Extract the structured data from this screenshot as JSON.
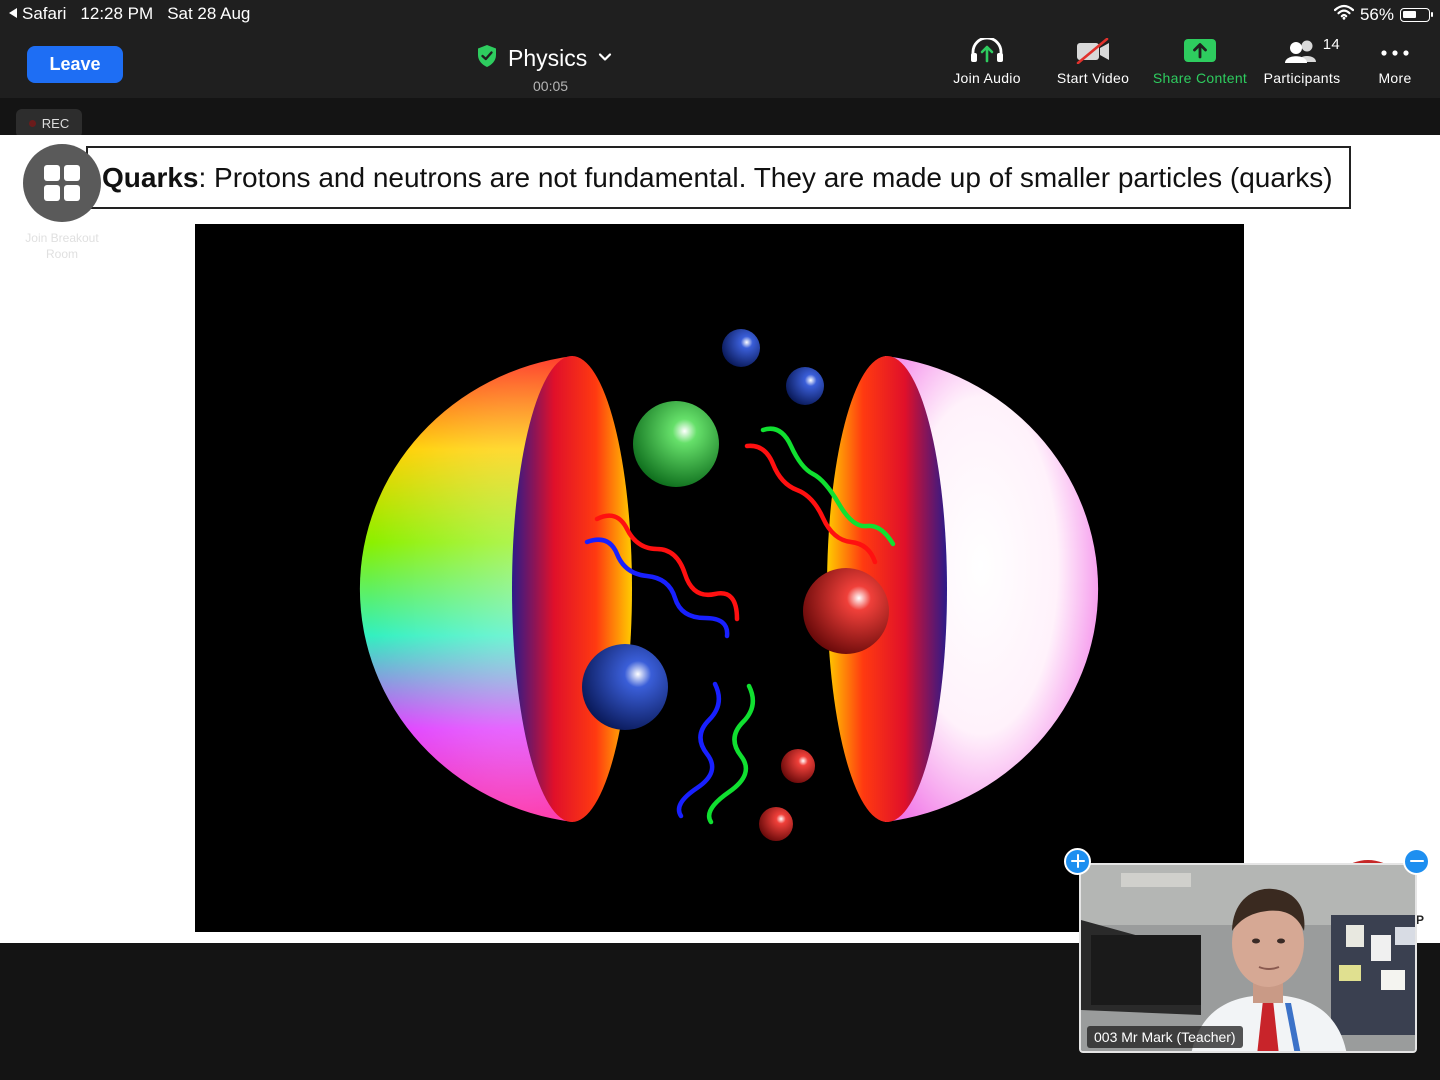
{
  "status_bar": {
    "back_app": "Safari",
    "time": "12:28 PM",
    "date": "Sat 28 Aug",
    "battery": "56%",
    "battery_level": 0.56
  },
  "top_bar": {
    "leave_label": "Leave",
    "meeting_title": "Physics",
    "timer": "00:05",
    "tools": [
      {
        "label": "Join Audio",
        "icon": "headphones-icon"
      },
      {
        "label": "Start Video",
        "icon": "video-off-icon"
      },
      {
        "label": "Share Content",
        "icon": "share-up-arrow-icon"
      },
      {
        "label": "Participants",
        "icon": "participants-icon",
        "count": "14"
      },
      {
        "label": "More",
        "icon": "more-dots-icon"
      }
    ]
  },
  "rec_label": "REC",
  "breakout": {
    "label": "Join Breakout Room"
  },
  "slide": {
    "title_bold": "Quarks",
    "title_rest": ": Protons and neutrons are not fundamental. They are made up of smaller particles (quarks)"
  },
  "video": {
    "participant_name": "003 Mr Mark (Teacher)"
  },
  "colors": {
    "leave_button": "#1e6ef4",
    "share_green": "#2ecc5f",
    "security_shield": "#2ecc5f"
  }
}
